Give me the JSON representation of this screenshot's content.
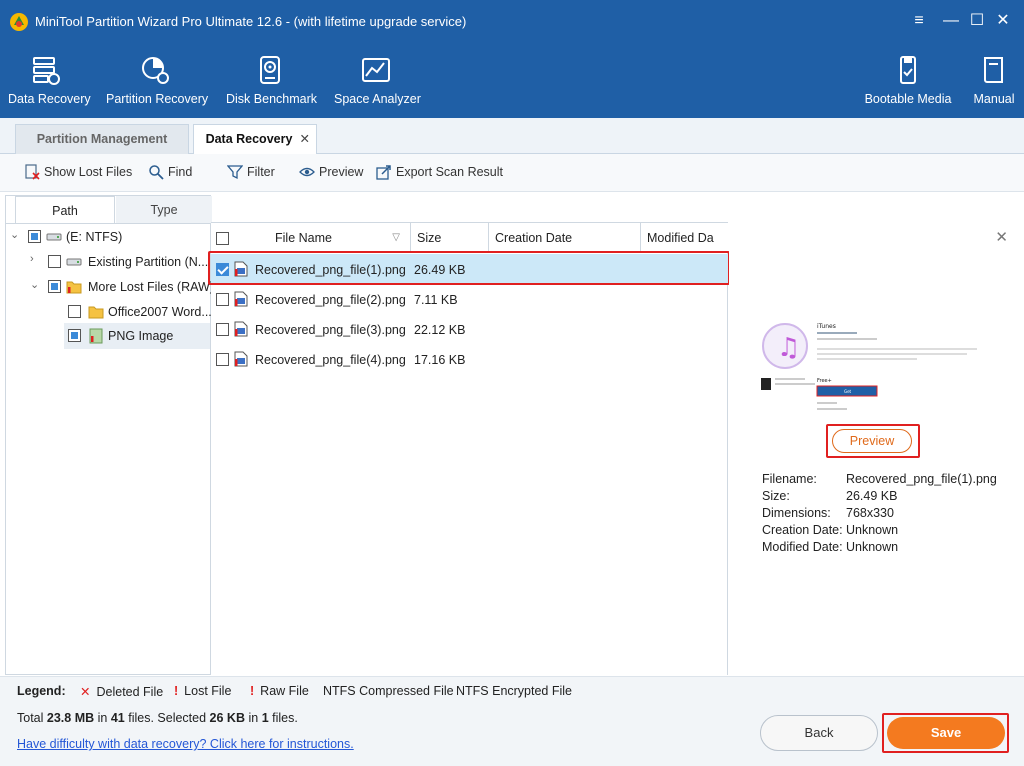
{
  "window": {
    "title": "MiniTool Partition Wizard Pro Ultimate 12.6 - (with lifetime upgrade service)",
    "controls": [
      "menu",
      "minimize",
      "maximize",
      "close"
    ]
  },
  "ribbon": {
    "left": [
      {
        "label": "Data Recovery",
        "icon": "data-recovery-icon"
      },
      {
        "label": "Partition Recovery",
        "icon": "partition-recovery-icon"
      },
      {
        "label": "Disk Benchmark",
        "icon": "disk-benchmark-icon"
      },
      {
        "label": "Space Analyzer",
        "icon": "space-analyzer-icon"
      }
    ],
    "right": [
      {
        "label": "Bootable Media",
        "icon": "bootable-media-icon"
      },
      {
        "label": "Manual",
        "icon": "manual-icon"
      }
    ]
  },
  "tabs": [
    {
      "label": "Partition Management",
      "active": false
    },
    {
      "label": "Data Recovery",
      "active": true,
      "closable": true
    }
  ],
  "toolbar": [
    {
      "label": "Show Lost Files",
      "icon": "show-lost-files-icon"
    },
    {
      "label": "Find",
      "icon": "find-icon"
    },
    {
      "label": "Filter",
      "icon": "filter-icon"
    },
    {
      "label": "Preview",
      "icon": "preview-eye-icon"
    },
    {
      "label": "Export Scan Result",
      "icon": "export-icon"
    }
  ],
  "left_panel": {
    "tabs": [
      "Path",
      "Type"
    ],
    "tree": [
      {
        "label": "(E: NTFS)",
        "state": "partial",
        "expander": "down"
      },
      {
        "label": "Existing Partition (N...",
        "state": "unchecked",
        "expander": "right"
      },
      {
        "label": "More Lost Files (RAW)",
        "state": "partial",
        "expander": "down"
      },
      {
        "label": "Office2007 Word...",
        "state": "unchecked",
        "expander": ""
      },
      {
        "label": "PNG Image",
        "state": "partial",
        "expander": ""
      }
    ]
  },
  "file_list": {
    "columns": [
      "File Name",
      "Size",
      "Creation Date",
      "Modified Da"
    ],
    "rows": [
      {
        "name": "Recovered_png_file(1).png",
        "size": "26.49 KB",
        "checked": true,
        "selected": true
      },
      {
        "name": "Recovered_png_file(2).png",
        "size": "7.11 KB",
        "checked": false,
        "selected": false
      },
      {
        "name": "Recovered_png_file(3).png",
        "size": "22.12 KB",
        "checked": false,
        "selected": false
      },
      {
        "name": "Recovered_png_file(4).png",
        "size": "17.16 KB",
        "checked": false,
        "selected": false
      }
    ]
  },
  "preview": {
    "button_label": "Preview",
    "info": [
      {
        "key": "Filename:",
        "value": "Recovered_png_file(1).png"
      },
      {
        "key": "Size:",
        "value": "26.49 KB"
      },
      {
        "key": "Dimensions:",
        "value": "768x330"
      },
      {
        "key": "Creation Date:",
        "value": "Unknown"
      },
      {
        "key": "Modified Date:",
        "value": "Unknown"
      }
    ],
    "thumb": {
      "app_name": "iTunes",
      "cta": "Get",
      "price": "Free+"
    }
  },
  "legend": {
    "title": "Legend:",
    "items": [
      {
        "marker": "✕",
        "label": "Deleted File",
        "color": "#e02020"
      },
      {
        "marker": "!",
        "label": "Lost File",
        "color": "#e02020"
      },
      {
        "marker": "!",
        "label": "Raw File",
        "color": "#e02020"
      },
      {
        "marker": "",
        "label": "NTFS Compressed File",
        "color": "#222222"
      },
      {
        "marker": "",
        "label": "NTFS Encrypted File",
        "color": "#222222"
      }
    ]
  },
  "status": {
    "total_prefix": "Total",
    "total_size": "23.8 MB",
    "in_text": "in",
    "total_files": "41",
    "files_text": "files.  Selected",
    "selected_size": "26 KB",
    "in_text2": "in",
    "selected_files": "1",
    "files_text2": "files.",
    "help_link": "Have difficulty with data recovery? Click here for instructions."
  },
  "buttons": {
    "back": "Back",
    "save": "Save"
  },
  "colors": {
    "ribbon_bg": "#1f5fa6",
    "accent_orange": "#f47a1f",
    "selection": "#cce8f8",
    "highlight_red": "#e02020"
  }
}
